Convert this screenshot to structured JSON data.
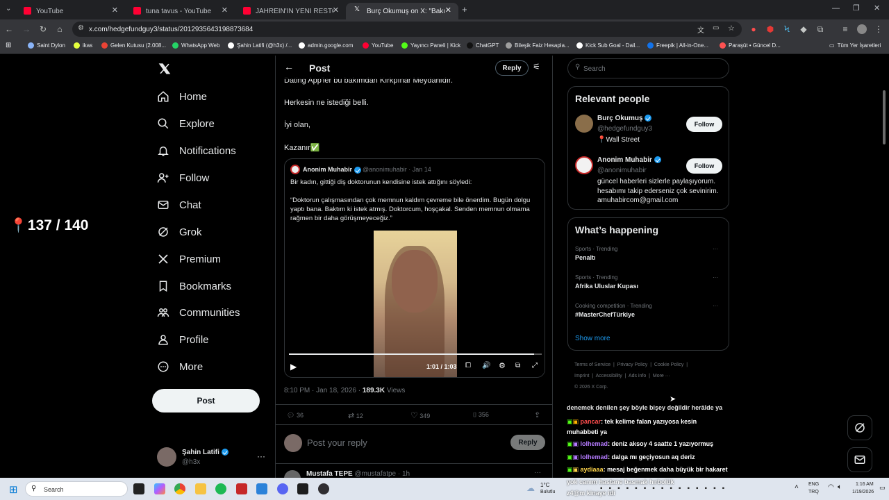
{
  "browser": {
    "tabs": [
      {
        "title": "YouTube",
        "fav": "#ff0033"
      },
      {
        "title": "tuna tavus - YouTube",
        "fav": "#ff0033"
      },
      {
        "title": "JAHREIN'IN YENİ RESTORANINA",
        "fav": "#ff0033"
      },
      {
        "title": "Burç Okumuş on X: \"Bakın insan",
        "fav": "#ffffff"
      }
    ],
    "url": "x.com/hedgefundguy3/status/2012935643198873684",
    "bookmarks": [
      "Saint Dylon",
      "ikas",
      "Gelen Kutusu (2.008...",
      "WhatsApp Web",
      "Şahin Latifi (@h3x) /...",
      "admin.google.com",
      "YouTube",
      "Yayıncı Paneli | Kick",
      "ChatGPT",
      "Bileşik Faiz Hesapla...",
      "Kick Sub Goal - Dail...",
      "Freepik | All-in-One...",
      "Paraşüt • Güncel D..."
    ],
    "all_bookmarks": "Tüm Yer İşaretleri"
  },
  "overlay": {
    "counter": "137 / 140"
  },
  "nav": {
    "items": [
      "Home",
      "Explore",
      "Notifications",
      "Follow",
      "Chat",
      "Grok",
      "Premium",
      "Bookmarks",
      "Communities",
      "Profile",
      "More"
    ],
    "post_button": "Post",
    "account": {
      "name": "Şahin Latifi",
      "handle": "@h3x"
    }
  },
  "post": {
    "header_title": "Post",
    "reply_button": "Reply",
    "text_lines": [
      "Dating App'ler bu bakımdan Kırkpınar Meydanıdır.",
      "Herkesin ne istediği belli.",
      "İyi olan,",
      "Kazanır✅"
    ],
    "quote": {
      "author": "Anonim Muhabir",
      "handle": "@anonimuhabir",
      "date": "Jan 14",
      "line1": "Bir kadın, gittiği diş doktorunun kendisine istek attığını söyledi:",
      "line2": "“Doktorun çalışmasından çok memnun kaldım çevreme bile önerdim. Bugün dolgu yaptı bana. Baktım ki istek atmış. Doktorcum, hoşçakal. Senden memnun olmama rağmen bir daha görüşmeyeceğiz.”",
      "video_time": "1:01 / 1:03",
      "video_progress": 0.97
    },
    "meta": "8:10 PM · Jan 18, 2026 · ",
    "views_count": "189.3K",
    "views_label": "Views",
    "stats": {
      "replies": "36",
      "reposts": "12",
      "likes": "349",
      "bookmarks": "356"
    },
    "reply_placeholder": "Post your reply",
    "reply_action": "Reply",
    "next_reply": {
      "name": "Mustafa TEPE",
      "handle": "@mustafatpe",
      "time": "· 1h"
    }
  },
  "sidebar": {
    "search_placeholder": "Search",
    "relevant_title": "Relevant people",
    "people": [
      {
        "name": "Burç Okumuş",
        "handle": "@hedgefundguy3",
        "bio": "📍Wall Street",
        "follow": "Follow"
      },
      {
        "name": "Anonim Muhabir",
        "handle": "@anonimuhabir",
        "bio": "güncel haberleri sizlerle paylaşıyorum. hesabımı takip ederseniz çok sevinirim. amuhabircom@gmail.com",
        "follow": "Follow"
      }
    ],
    "happening_title": "What’s happening",
    "trends": [
      {
        "meta": "Sports · Trending",
        "name": "Penaltı"
      },
      {
        "meta": "Sports · Trending",
        "name": "Afrika Uluslar Kupası"
      },
      {
        "meta": "Cooking competition · Trending",
        "name": "#MasterChefTürkiye"
      }
    ],
    "show_more": "Show more",
    "footer": [
      "Terms of Service",
      "Privacy Policy",
      "Cookie Policy",
      "Imprint",
      "Accessibility",
      "Ads info",
      "More ···"
    ],
    "copyright": "© 2026 X Corp."
  },
  "stream_chat": [
    {
      "user": "",
      "msg": "denemek denilen şey böyle bişey değildir herälde ya",
      "color": "#ffffff"
    },
    {
      "user": "pancar",
      "msg": ": tek kelime falan yazıyosa kesin muhabbeti ya",
      "color": "#ff4d4d"
    },
    {
      "user": "lolhemad",
      "msg": ": deniz aksoy 4 saatte 1 yazıyormuş",
      "color": "#b57bff"
    },
    {
      "user": "lolhemad",
      "msg": ": dalga mı geçiyosun aq deriz",
      "color": "#b57bff"
    },
    {
      "user": "aydiaaa",
      "msg": ": mesaj beğenmek daha büyük bir hakaret",
      "color": "#ffd54a"
    },
    {
      "user": "",
      "msg": "yok canım hastane basmak hırbolük",
      "color": "#ffffff"
    },
    {
      "user": "",
      "msg": "z4@m kinaye idi",
      "color": "#ffffff"
    }
  ],
  "taskbar": {
    "search": "Search",
    "weather_temp": "1°C",
    "weather_desc": "Bulutlu",
    "lang1": "ENG",
    "lang2": "TRQ",
    "time": "1:16 AM",
    "date": "1/19/2026"
  }
}
